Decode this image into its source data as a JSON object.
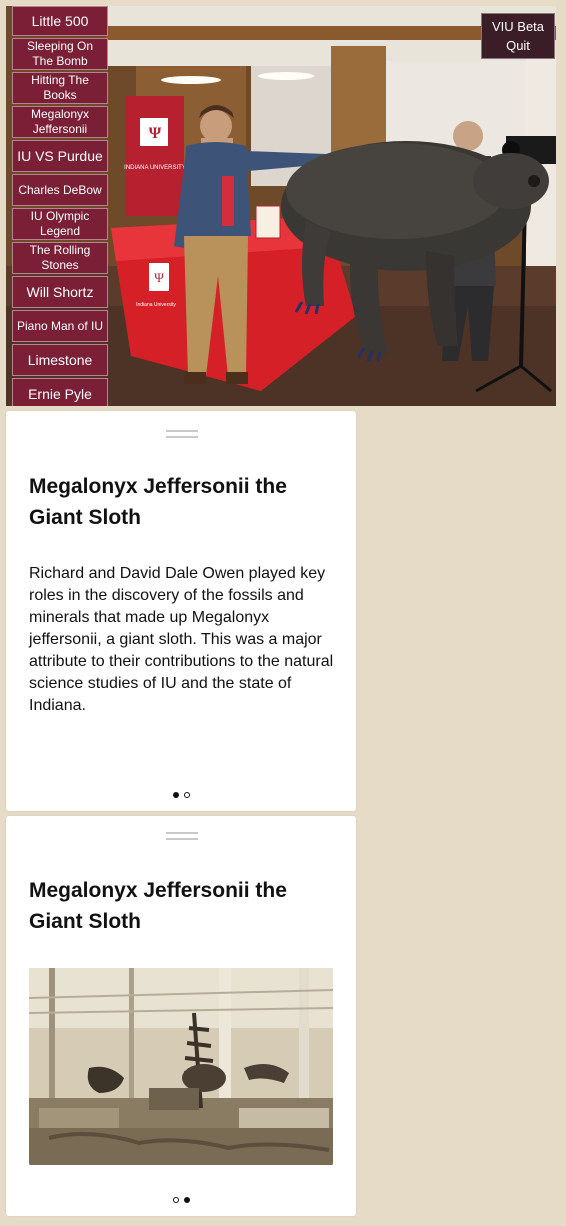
{
  "menu": {
    "items": [
      {
        "label": "Little 500",
        "size": "big"
      },
      {
        "label": "Sleeping On The Bomb",
        "size": "small"
      },
      {
        "label": "Hitting The Books",
        "size": "small"
      },
      {
        "label": "Megalonyx Jeffersonii",
        "size": "small"
      },
      {
        "label": "IU VS Purdue",
        "size": "big"
      },
      {
        "label": "Charles DeBow",
        "size": "small"
      },
      {
        "label": "IU Olympic Legend",
        "size": "small"
      },
      {
        "label": "The Rolling Stones",
        "size": "small"
      },
      {
        "label": "Will Shortz",
        "size": "big"
      },
      {
        "label": "Piano Man of IU",
        "size": "small"
      },
      {
        "label": "Limestone",
        "size": "big"
      },
      {
        "label": "Ernie Pyle",
        "size": "big"
      }
    ]
  },
  "top_right": {
    "line1": "VIU Beta",
    "line2": "Quit"
  },
  "scene": {
    "banner_text": "INDIANA UNIVERSITY",
    "tablecloth_text": "Indiana University"
  },
  "card1": {
    "title": "Megalonyx Jeffersonii the Giant Sloth",
    "body": "Richard and David Dale Owen played key roles in the discovery of the fossils and minerals that made up Megalonyx jeffersonii, a giant sloth. This was a major attribute to their contributions to the natural science studies of IU and the state of Indiana.",
    "page": 1,
    "pages": 2
  },
  "card2": {
    "title": "Megalonyx Jeffersonii the Giant Sloth",
    "photo": "historic museum hall with sloth skeleton",
    "page": 2,
    "pages": 2
  },
  "colors": {
    "menu_bg": "#7a1f35",
    "quit_bg": "#3a1d26",
    "page_bg": "#e5dbc6"
  }
}
